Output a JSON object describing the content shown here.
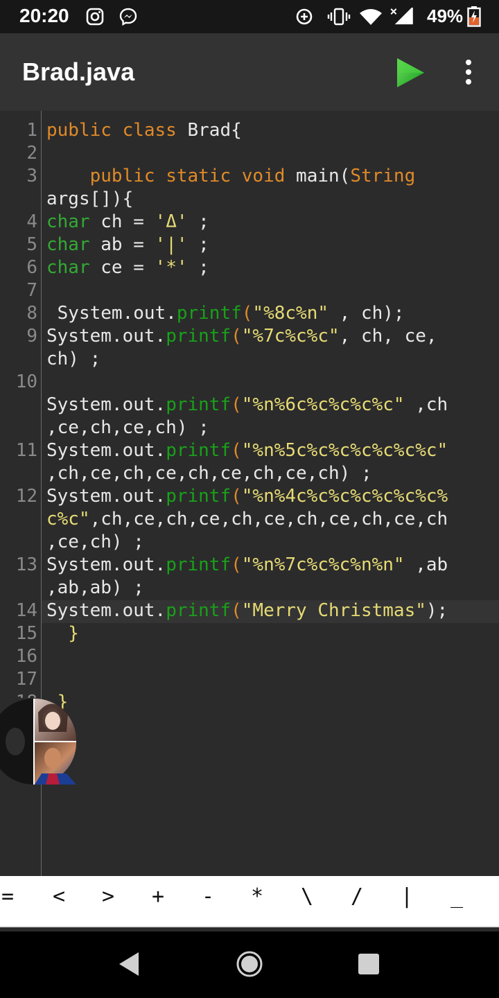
{
  "status_bar": {
    "time": "20:20",
    "battery_percent": "49%",
    "icons": [
      "instagram-icon",
      "messenger-icon",
      "data-saver-icon",
      "vibrate-icon",
      "wifi-icon",
      "no-signal-icon",
      "battery-charging-icon"
    ]
  },
  "app_bar": {
    "title": "Brad.java",
    "actions": [
      "run-icon",
      "more-vert-icon"
    ]
  },
  "editor": {
    "line_numbers": [
      "1",
      "2",
      "3",
      "4",
      "5",
      "6",
      "7",
      "8",
      "9",
      "10",
      "11",
      "12",
      "13",
      "14",
      "15",
      "16",
      "17",
      "18"
    ],
    "lines": {
      "l1": {
        "kw": "public class",
        "rest": " Brad{"
      },
      "l3a": {
        "indent": "    ",
        "kw": "public static void",
        "rest": " main(",
        "type": "String"
      },
      "l3b": {
        "rest": "args[]){"
      },
      "l4": {
        "type": "char",
        "rest": " ch = ",
        "lit": "'Δ'",
        "end": " ;"
      },
      "l5": {
        "type": "char",
        "rest": " ab = ",
        "lit": "'|'",
        "end": " ;"
      },
      "l6": {
        "type": "char",
        "rest": " ce = ",
        "lit": "'*'",
        "end": " ;"
      },
      "l8": {
        "pre": " System.out.",
        "fn": "printf",
        "open": "(",
        "str": "\"%8c%n\"",
        "post": " , ch);"
      },
      "l9a": {
        "pre": "System.out.",
        "fn": "printf",
        "open": "(",
        "str": "\"%7c%c%c\"",
        "post": ", ch, ce,"
      },
      "l9b": {
        "rest": "ch) ;"
      },
      "l10a": {
        "pre": "System.out.",
        "fn": "printf",
        "open": "(",
        "str": "\"%n%6c%c%c%c%c\"",
        "post": " ,ch"
      },
      "l10b": {
        "rest": ",ce,ch,ce,ch) ;"
      },
      "l11a": {
        "pre": "System.out.",
        "fn": "printf",
        "open": "(",
        "str": "\"%n%5c%c%c%c%c%c%c\""
      },
      "l11b": {
        "rest": ",ch,ce,ch,ce,ch,ce,ch,ce,ch) ;"
      },
      "l12a": {
        "pre": "System.out.",
        "fn": "printf",
        "open": "(",
        "str": "\"%n%4c%c%c%c%c%c%c%"
      },
      "l12b": {
        "str": "c%c\"",
        "rest": ",ch,ce,ch,ce,ch,ce,ch,ce,ch,ce,ch"
      },
      "l12c": {
        "rest": ",ce,ch) ;"
      },
      "l13a": {
        "pre": "System.out.",
        "fn": "printf",
        "open": "(",
        "str": "\"%n%7c%c%c%n%n\"",
        "post": " ,ab"
      },
      "l13b": {
        "rest": ",ab,ab) ;"
      },
      "l14": {
        "pre": "System.out.",
        "fn": "printf",
        "open": "(",
        "str": "\"Merry Christmas\"",
        "post": ");"
      },
      "l15": {
        "rest": "  }"
      },
      "l18": {
        "rest": " }"
      }
    }
  },
  "symbol_bar": {
    "symbols": [
      "=",
      "<",
      ">",
      "+",
      "-",
      "*",
      "\\",
      "/",
      "|",
      "_"
    ]
  },
  "colors": {
    "keyword": "#e08a28",
    "type": "#33aa33",
    "method": "#19a119",
    "string": "#e6db74",
    "text": "#e8e8e8",
    "editor_bg": "#2b2b2c",
    "appbar_bg": "#333333"
  }
}
